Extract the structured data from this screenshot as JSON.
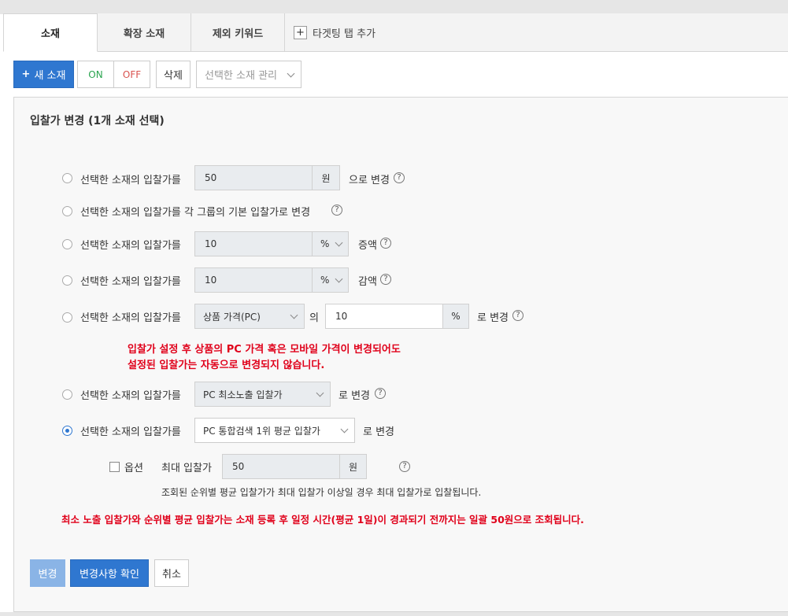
{
  "tabs": [
    {
      "label": "소재",
      "active": true
    },
    {
      "label": "확장 소재",
      "active": false
    },
    {
      "label": "제외 키워드",
      "active": false
    }
  ],
  "tab_add": {
    "icon": "plus-icon",
    "label": "타겟팅 탭 추가"
  },
  "toolbar": {
    "new_label": "새 소재",
    "new_icon": "+",
    "on_label": "ON",
    "off_label": "OFF",
    "delete_label": "삭제",
    "manage_placeholder": "선택한 소재 관리"
  },
  "panel": {
    "title": "입찰가 변경 (1개 소재 선택)",
    "options": [
      {
        "prefix": "선택한 소재의 입찰가를",
        "value": "50",
        "unit": "원",
        "suffix": "으로 변경",
        "selected": false
      },
      {
        "prefix": "선택한 소재의 입찰가를 각 그룹의 기본 입찰가로 변경",
        "selected": false
      },
      {
        "prefix": "선택한 소재의 입찰가를",
        "value": "10",
        "unit": "%",
        "suffix": "증액",
        "selected": false
      },
      {
        "prefix": "선택한 소재의 입찰가를",
        "value": "10",
        "unit": "%",
        "suffix": "감액",
        "selected": false
      },
      {
        "prefix": "선택한 소재의 입찰가를",
        "select": "상품 가격(PC)",
        "mid": "의",
        "value": "10",
        "unit": "%",
        "suffix": "로 변경",
        "selected": false
      },
      {
        "prefix": "선택한 소재의 입찰가를",
        "select": "PC 최소노출 입찰가",
        "suffix": "로 변경",
        "selected": false
      },
      {
        "prefix": "선택한 소재의 입찰가를",
        "select": "PC 통합검색 1위 평균 입찰가",
        "suffix": "로 변경",
        "selected": true
      }
    ],
    "warning_lines": [
      "입찰가 설정 후 상품의 PC 가격 혹은 모바일 가격이 변경되어도",
      "설정된 입찰가는 자동으로 변경되지 않습니다."
    ],
    "option_checkbox": {
      "label": "옵션",
      "checked": false
    },
    "max_bid": {
      "label": "최대 입찰가",
      "value": "50",
      "unit": "원"
    },
    "max_bid_note": "조회된 순위별 평균 입찰가가 최대 입찰가 이상일 경우 최대 입찰가로 입찰됩니다.",
    "bottom_warning": "최소 노출 입찰가와 순위별 평균 입찰가는 소재 등록 후 일정 시간(평균 1일)이 경과되기 전까지는 일괄 50원으로 조회됩니다.",
    "help_icon": "?"
  },
  "actions": {
    "change_label": "변경",
    "confirm_label": "변경사항 확인",
    "cancel_label": "취소"
  },
  "colors": {
    "primary": "#2f77d0",
    "warning": "#e0001a",
    "on": "#2aa44f",
    "off": "#d9534f"
  }
}
